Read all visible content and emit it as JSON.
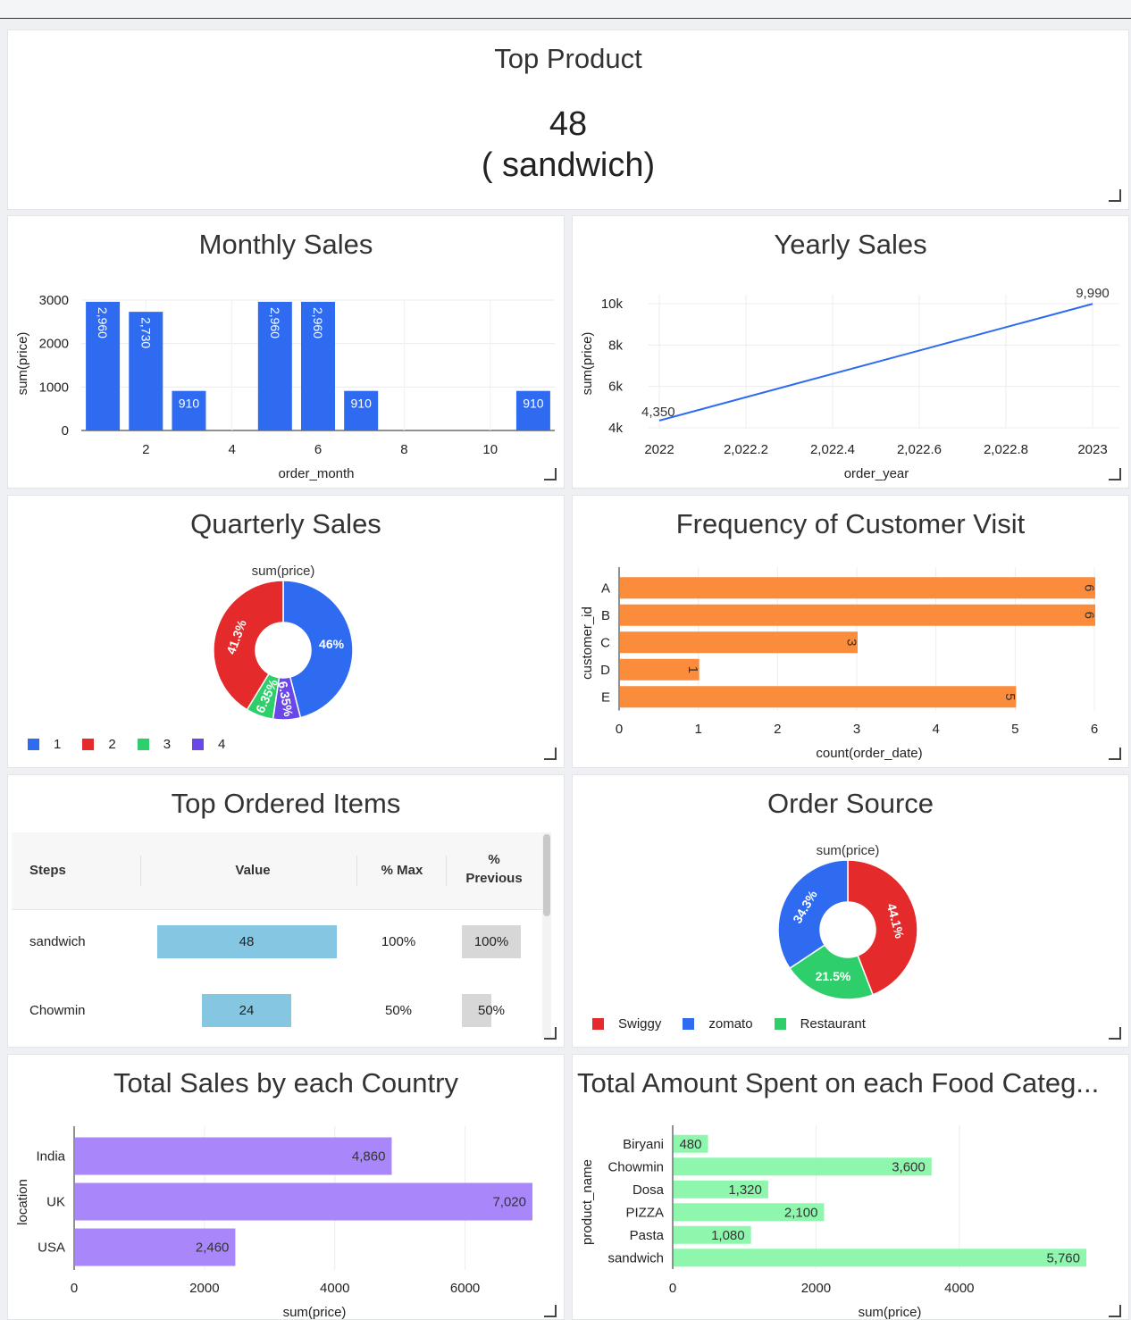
{
  "top_product": {
    "title": "Top Product",
    "value": "48",
    "subtitle": "( sandwich)"
  },
  "monthly_sales": {
    "title": "Monthly Sales",
    "xlabel": "order_month",
    "ylabel": "sum(price)"
  },
  "yearly_sales": {
    "title": "Yearly Sales",
    "xlabel": "order_year",
    "ylabel": "sum(price)"
  },
  "quarterly_sales": {
    "title": "Quarterly Sales",
    "inner_title": "sum(price)",
    "legend": [
      {
        "label": "1",
        "color": "#2f6bf0"
      },
      {
        "label": "2",
        "color": "#e42a2a"
      },
      {
        "label": "3",
        "color": "#2ecf6a"
      },
      {
        "label": "4",
        "color": "#6a48e8"
      }
    ]
  },
  "customer_visits": {
    "title": "Frequency of Customer Visit",
    "xlabel": "count(order_date)",
    "ylabel": "customer_id"
  },
  "top_ordered_items": {
    "title": "Top Ordered Items",
    "headers": {
      "steps": "Steps",
      "value": "Value",
      "max": "% Max",
      "previous_line1": "%",
      "previous_line2": "Previous"
    },
    "rows": [
      {
        "step": "sandwich",
        "value": "48",
        "max": "100%",
        "previous": "100%",
        "fraction": 1.0
      },
      {
        "step": "Chowmin",
        "value": "24",
        "max": "50%",
        "previous": "50%",
        "fraction": 0.5
      }
    ]
  },
  "order_source": {
    "title": "Order Source",
    "inner_title": "sum(price)",
    "legend": [
      {
        "label": "Swiggy",
        "color": "#e42a2a"
      },
      {
        "label": "zomato",
        "color": "#2f6bf0"
      },
      {
        "label": "Restaurant",
        "color": "#2ecf6a"
      }
    ]
  },
  "country_sales": {
    "title": "Total Sales by each Country",
    "xlabel": "sum(price)",
    "ylabel": "location"
  },
  "food_category": {
    "title": "Total Amount Spent on each Food Categ...",
    "xlabel": "sum(price)",
    "ylabel": "product_name"
  },
  "colors": {
    "blue": "#2f6bf0",
    "orange": "#fb8c3c",
    "purple": "#a987fa",
    "mint": "#8ef7ad",
    "funnel_bar": "#85c7e3"
  },
  "chart_data": [
    {
      "id": "monthly",
      "type": "bar",
      "x": [
        1,
        2,
        3,
        5,
        6,
        7,
        11
      ],
      "values": [
        2960,
        2730,
        910,
        2960,
        2960,
        910,
        910
      ],
      "data_labels": [
        "2,960",
        "2,730",
        "910",
        "2,960",
        "2,960",
        "910",
        "910"
      ],
      "xticks": [
        "2",
        "4",
        "6",
        "8",
        "10"
      ],
      "yticks": [
        "0",
        "1000",
        "2000",
        "3000"
      ],
      "ylim": [
        0,
        3000
      ],
      "xlim": [
        0.5,
        11.5
      ]
    },
    {
      "id": "yearly",
      "type": "line",
      "x": [
        2022,
        2023
      ],
      "values": [
        4350,
        9990
      ],
      "data_labels": [
        "4,350",
        "9,990"
      ],
      "xticks": [
        "2022",
        "2,022.2",
        "2,022.4",
        "2,022.6",
        "2,022.8",
        "2023"
      ],
      "yticks": [
        "4k",
        "6k",
        "8k",
        "10k"
      ],
      "ylim": [
        4000,
        10000
      ]
    },
    {
      "id": "quarterly",
      "type": "pie",
      "labels": [
        "1",
        "4",
        "3",
        "2"
      ],
      "values": [
        46,
        6.35,
        6.35,
        41.3
      ],
      "data_labels": [
        "46%",
        "6.35%",
        "6.35%",
        "41.3%"
      ],
      "colors": [
        "#2f6bf0",
        "#6a48e8",
        "#2ecf6a",
        "#e42a2a"
      ]
    },
    {
      "id": "customers",
      "type": "bar",
      "orientation": "horizontal",
      "categories": [
        "A",
        "B",
        "C",
        "D",
        "E"
      ],
      "values": [
        6,
        6,
        3,
        1,
        5
      ],
      "data_labels": [
        "6",
        "6",
        "3",
        "1",
        "5"
      ],
      "xticks": [
        "0",
        "1",
        "2",
        "3",
        "4",
        "5",
        "6"
      ],
      "xlim": [
        0,
        6
      ]
    },
    {
      "id": "order_source",
      "type": "pie",
      "labels": [
        "Swiggy",
        "Restaurant",
        "zomato"
      ],
      "values": [
        44.1,
        21.5,
        34.3
      ],
      "data_labels": [
        "44.1%",
        "21.5%",
        "34.3%"
      ],
      "colors": [
        "#e42a2a",
        "#2ecf6a",
        "#2f6bf0"
      ]
    },
    {
      "id": "country",
      "type": "bar",
      "orientation": "horizontal",
      "categories": [
        "India",
        "UK",
        "USA"
      ],
      "values": [
        4860,
        7020,
        2460
      ],
      "data_labels": [
        "4,860",
        "7,020",
        "2,460"
      ],
      "xticks": [
        "0",
        "2000",
        "4000",
        "6000"
      ],
      "xlim": [
        0,
        7020
      ]
    },
    {
      "id": "food",
      "type": "bar",
      "orientation": "horizontal",
      "categories": [
        "Biryani",
        "Chowmin",
        "Dosa",
        "PIZZA",
        "Pasta",
        "sandwich"
      ],
      "values": [
        480,
        3600,
        1320,
        2100,
        1080,
        5760
      ],
      "data_labels": [
        "480",
        "3,600",
        "1,320",
        "2,100",
        "1,080",
        "5,760"
      ],
      "xticks": [
        "0",
        "2000",
        "4000"
      ],
      "xlim": [
        0,
        5760
      ]
    }
  ]
}
